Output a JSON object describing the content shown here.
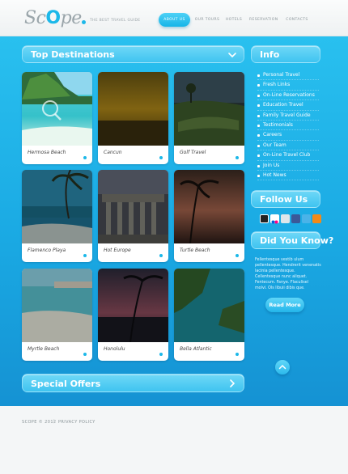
{
  "brand": {
    "logo_left": "Sc",
    "logo_accent": "O",
    "logo_right": "pe",
    "tagline": "THE BEST TRAVEL GUIDE",
    "accent_color": "#1cb8e9"
  },
  "nav": {
    "items": [
      {
        "label": "ABOUT US",
        "active": true
      },
      {
        "label": "OUR TOURS",
        "active": false
      },
      {
        "label": "HOTELS",
        "active": false
      },
      {
        "label": "RESERVATION",
        "active": false
      },
      {
        "label": "CONTACTS",
        "active": false
      }
    ]
  },
  "destinations": {
    "title": "Top Destinations",
    "icon": "chevron-down-icon",
    "items": [
      {
        "caption": "Hermosa Beach"
      },
      {
        "caption": "Cancun"
      },
      {
        "caption": "Golf Travel"
      },
      {
        "caption": "Flamenco Playa"
      },
      {
        "caption": "Hot Europe"
      },
      {
        "caption": "Turtle Beach"
      },
      {
        "caption": "Myrtle Beach"
      },
      {
        "caption": "Honolulu"
      },
      {
        "caption": "Bella Atlantic"
      }
    ]
  },
  "info": {
    "title": "Info",
    "items": [
      "Personal Travel",
      "Fresh Links",
      "On-Line Reservations",
      "Education Travel",
      "Family Travel Guide",
      "Testimonials",
      "Careers",
      "Our Team",
      "On-Line Travel Club",
      "Join Us",
      "Hot News"
    ]
  },
  "follow": {
    "title": "Follow Us",
    "icons": [
      "delicious-icon",
      "flickr-icon",
      "digg-icon",
      "facebook-icon",
      "twitter-icon",
      "rss-icon"
    ]
  },
  "did_you_know": {
    "title": "Did You Know?",
    "text": "Fellentesque vestib ulum pellentesque. Hendrerit venenatis lacinia pellentesque. Cellentesque nunc aliquet. Fentecum. Fanye. Flaculisel molvi. Ols libuii dibis que.",
    "more_label": "Read More",
    "up_icon": "chevron-up-icon"
  },
  "special_offers": {
    "title": "Special Offers",
    "icon": "chevron-right-icon"
  },
  "footer": {
    "copyright": "SCOPE © 2012",
    "separator": "|",
    "link": "PRIVACY POLICY"
  }
}
